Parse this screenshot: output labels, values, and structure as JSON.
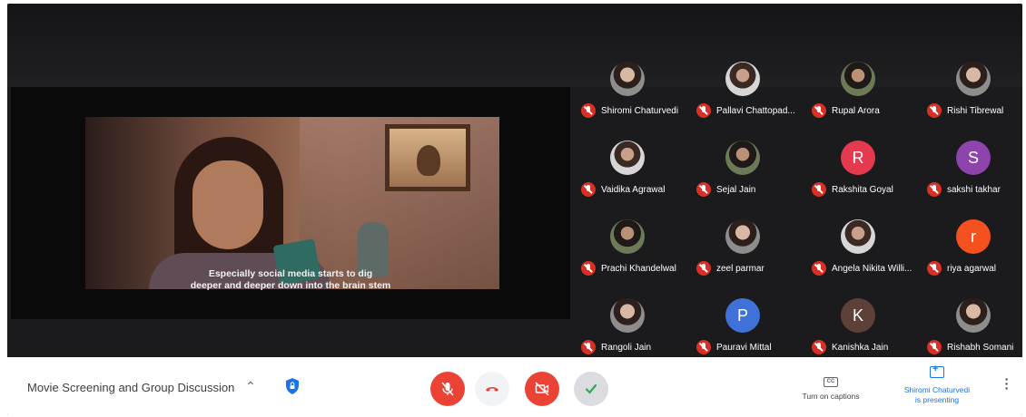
{
  "presentation": {
    "caption_line1": "Especially social media starts to dig",
    "caption_line2": "deeper and deeper down into the brain stem"
  },
  "participants": [
    {
      "name": "Shiromi Chaturvedi",
      "avatar": "photo",
      "muted": true
    },
    {
      "name": "Pallavi Chattopad...",
      "avatar": "photo",
      "muted": true
    },
    {
      "name": "Rupal Arora",
      "avatar": "photo",
      "muted": true
    },
    {
      "name": "Rishi Tibrewal",
      "avatar": "photo",
      "muted": true
    },
    {
      "name": "Vaidika Agrawal",
      "avatar": "photo",
      "muted": true
    },
    {
      "name": "Sejal Jain",
      "avatar": "photo",
      "muted": true
    },
    {
      "name": "Rakshita Goyal",
      "avatar": "R",
      "color": "#e53950",
      "muted": true
    },
    {
      "name": "sakshi takhar",
      "avatar": "S",
      "color": "#8e44ad",
      "muted": true
    },
    {
      "name": "Prachi Khandelwal",
      "avatar": "photo",
      "muted": true
    },
    {
      "name": "zeel parmar",
      "avatar": "photo",
      "muted": true
    },
    {
      "name": "Angela Nikita Willi...",
      "avatar": "photo",
      "muted": true
    },
    {
      "name": "riya agarwal",
      "avatar": "r",
      "color": "#f4511e",
      "muted": true
    },
    {
      "name": "Rangoli Jain",
      "avatar": "photo",
      "muted": true
    },
    {
      "name": "Pauravi Mittal",
      "avatar": "P",
      "color": "#3f71d8",
      "muted": true
    },
    {
      "name": "Kanishka Jain",
      "avatar": "K",
      "color": "#5d4037",
      "muted": true
    },
    {
      "name": "Rishabh Somani",
      "avatar": "photo",
      "muted": true
    }
  ],
  "bottom_bar": {
    "meeting_title": "Movie Screening and Group Discussion",
    "captions_label": "Turn on captions",
    "cc_text": "CC",
    "presenting_line1": "Shiromi Chaturvedi",
    "presenting_line2": "is presenting"
  },
  "colors": {
    "mute_red": "#ea4335",
    "accent_blue": "#1a73e8"
  }
}
